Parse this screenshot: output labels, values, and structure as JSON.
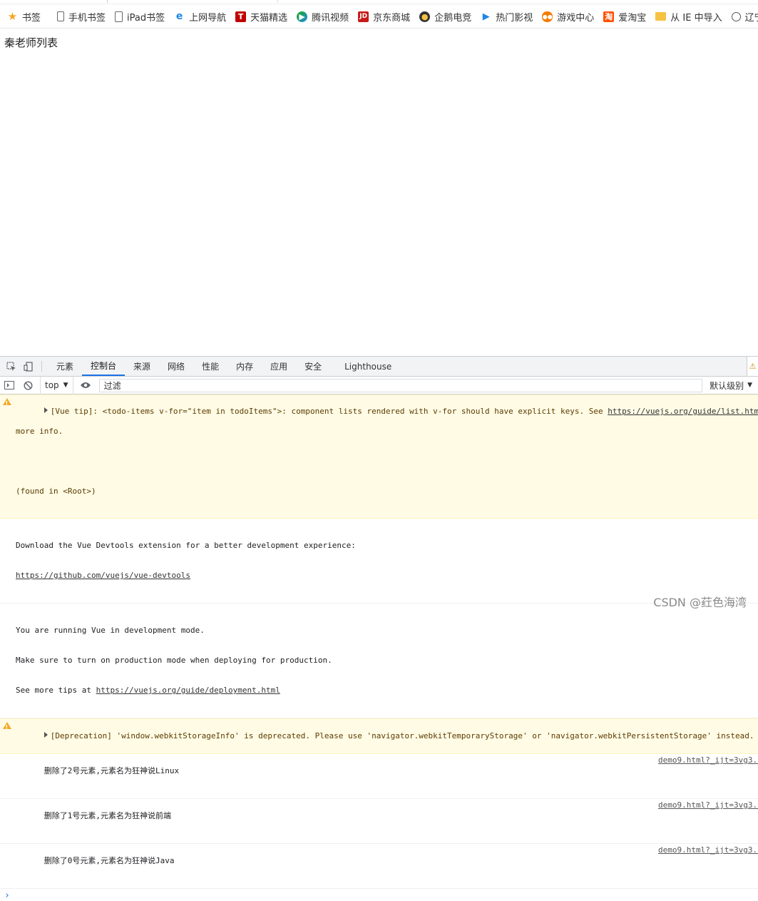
{
  "bookmarks": [
    {
      "label": "书签",
      "icon": "star-icon",
      "color": "#f5a623"
    },
    {
      "label": "手机书签",
      "icon": "phone-icon",
      "color": "#666666"
    },
    {
      "label": "iPad书签",
      "icon": "tablet-icon",
      "color": "#666666"
    },
    {
      "label": "上网导航",
      "icon": "ie-icon",
      "color": "#1e88e5"
    },
    {
      "label": "天猫精选",
      "icon": "tmall-icon",
      "color": "#c00000"
    },
    {
      "label": "腾讯视频",
      "icon": "tencent-video-icon",
      "color": "#1aad19"
    },
    {
      "label": "京东商城",
      "icon": "jd-icon",
      "color": "#c71a1a"
    },
    {
      "label": "企鹅电竞",
      "icon": "penguin-icon",
      "color": "#333333"
    },
    {
      "label": "热门影视",
      "icon": "play-icon",
      "color": "#1e88e5"
    },
    {
      "label": "游戏中心",
      "icon": "gamepad-icon",
      "color": "#f57c00"
    },
    {
      "label": "爱淘宝",
      "icon": "taobao-icon",
      "color": "#ff5000"
    },
    {
      "label": "从 IE 中导入",
      "icon": "folder-icon",
      "color": "#f5c242"
    },
    {
      "label": "辽宁工业大",
      "icon": "globe-icon",
      "color": "#555555"
    }
  ],
  "page": {
    "title": "秦老师列表"
  },
  "devtools": {
    "tabs": [
      "元素",
      "控制台",
      "来源",
      "网络",
      "性能",
      "内存",
      "应用",
      "安全",
      "Lighthouse"
    ],
    "active_tab": "控制台",
    "toolbar": {
      "context": "top",
      "filter_placeholder": "过滤",
      "levels": "默认级别"
    },
    "messages": [
      {
        "type": "warn",
        "lines": [
          "[Vue tip]: <todo-items v-for=\"item in todoItems\">: component lists rendered with v-for should have explicit keys. See ",
          "more info.",
          "",
          "(found in <Root>)"
        ],
        "link": "https://vuejs.org/guide/list.html#key",
        "link_suffix": " "
      },
      {
        "type": "log",
        "text1": "Download the Vue Devtools extension for a better development experience:",
        "link": "https://github.com/vuejs/vue-devtools"
      },
      {
        "type": "log",
        "text1": "You are running Vue in development mode.",
        "text2": "Make sure to turn on production mode when deploying for production.",
        "text3": "See more tips at ",
        "link": "https://vuejs.org/guide/deployment.html"
      },
      {
        "type": "warn",
        "text": "[Deprecation] 'window.webkitStorageInfo' is deprecated. Please use 'navigator.webkitTemporaryStorage' or 'navigator.webkitPersistentStorage' instead."
      },
      {
        "type": "log",
        "text": "删除了2号元素,元素名为狂神说Linux",
        "source": "demo9.html?_ijt=3vg3..."
      },
      {
        "type": "log",
        "text": "删除了1号元素,元素名为狂神说前端",
        "source": "demo9.html?_ijt=3vg3..."
      },
      {
        "type": "log",
        "text": "删除了0号元素,元素名为狂神说Java",
        "source": "demo9.html?_ijt=3vg3..."
      }
    ],
    "prompt": "›"
  },
  "watermark": "CSDN @荭色海湾"
}
